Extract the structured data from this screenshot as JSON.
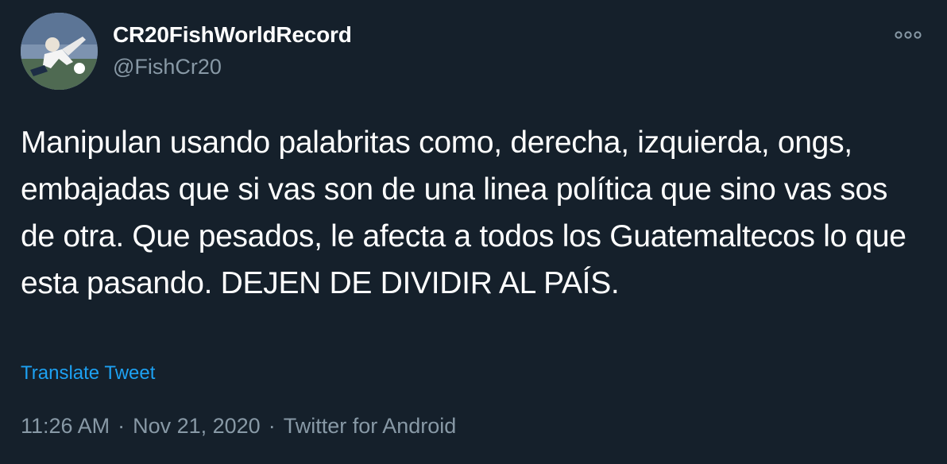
{
  "user": {
    "display_name": "CR20FishWorldRecord",
    "handle": "@FishCr20",
    "avatar_icon": "profile-photo-soccer-player"
  },
  "more_icon": "more-options-icon",
  "tweet": {
    "text": "Manipulan usando palabritas como, derecha, izquierda, ongs, embajadas que si vas son de una linea política que sino vas sos de otra. Que pesados, le afecta a todos los Guatemaltecos lo que esta pasando. DEJEN DE DIVIDIR AL PAÍS.",
    "translate_label": "Translate Tweet"
  },
  "meta": {
    "time": "11:26 AM",
    "separator": "·",
    "date": "Nov 21, 2020",
    "source": "Twitter for Android"
  },
  "colors": {
    "background": "#15202b",
    "text": "#ffffff",
    "secondary_text": "#8899a6",
    "link": "#1da1f2"
  }
}
